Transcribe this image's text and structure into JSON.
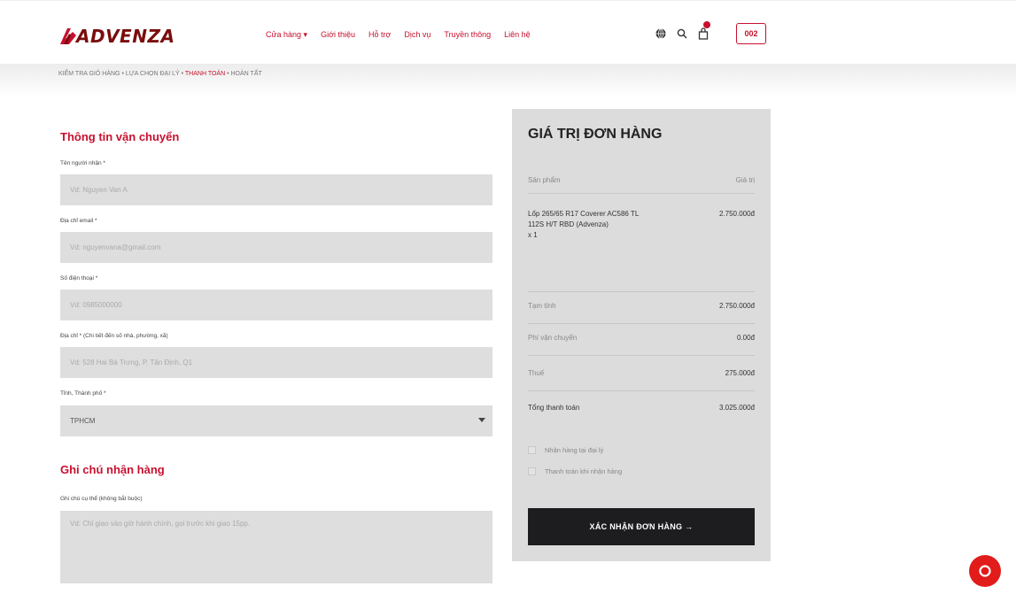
{
  "brand": {
    "name": "ADVENZA",
    "color": "#c8102e"
  },
  "nav": {
    "items": [
      "Cửa hàng ▾",
      "Giới thiệu",
      "Hỗ trợ",
      "Dịch vụ",
      "Truyền thông",
      "Liên hệ"
    ]
  },
  "header": {
    "code_label": "002"
  },
  "breadcrumb": {
    "step1": "KIỂM TRA GIỎ HÀNG •",
    "step2": "LỰA CHỌN ĐẠI LÝ •",
    "step3": "THANH TOÁN",
    "step4": "• HOÀN TẤT"
  },
  "shipping": {
    "title": "Thông tin vận chuyển",
    "fields": [
      {
        "label": "Tên người nhận *",
        "placeholder": "Vd: Nguyen Van A"
      },
      {
        "label": "Địa chỉ email *",
        "placeholder": "Vd: nguyenvana@gmail.com"
      },
      {
        "label": "Số điện thoại *",
        "placeholder": "Vd: 0985000000"
      },
      {
        "label": "Địa chỉ * (Chi tiết đến số nhà, phường, xã)",
        "placeholder": "Vd: 528 Hai Bà Trưng, P. Tân Định, Q1"
      },
      {
        "label": "Tỉnh, Thành phố *",
        "value": "TPHCM"
      }
    ]
  },
  "note": {
    "title": "Ghi chú nhận hàng",
    "label": "Ghi chú cụ thể (không bắt buộc)",
    "placeholder": "Vd: Chỉ giao vào giờ hành chính, gọi trước khi giao 15pp."
  },
  "summary": {
    "title": "GIÁ TRỊ ĐƠN HÀNG",
    "col_product": "Sản phẩm",
    "col_price": "Giá trị",
    "product_name": "Lốp 265/65 R17 Coverer AC586 TL 112S H/T RBD (Advenza)",
    "product_qty": "x 1",
    "product_price": "2.750.000đ",
    "subtotal_label": "Tạm tính",
    "subtotal": "2.750.000đ",
    "shipping_label": "Phí vận chuyển",
    "shipping": "0.00đ",
    "tax_label": "Thuế",
    "tax": "275.000đ",
    "total_label": "Tổng thanh toán",
    "total": "3.025.000đ",
    "option1": "Nhận hàng tại đại lý",
    "option2": "Thanh toán khi nhận hàng",
    "confirm_label": "XÁC NHẬN ĐƠN HÀNG →"
  }
}
